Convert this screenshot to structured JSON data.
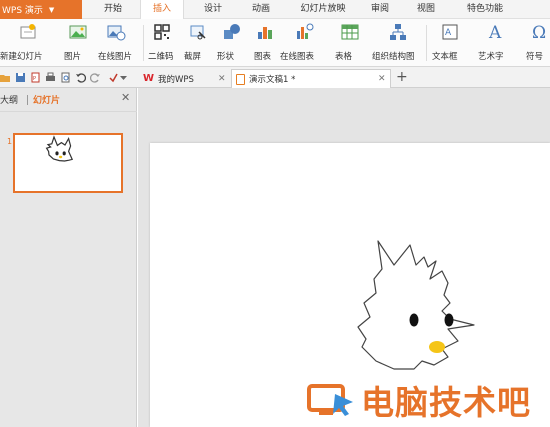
{
  "app": {
    "name": "WPS 演示"
  },
  "menu": {
    "tabs": [
      {
        "label": "开始"
      },
      {
        "label": "插入"
      },
      {
        "label": "设计"
      },
      {
        "label": "动画"
      },
      {
        "label": "幻灯片放映"
      },
      {
        "label": "审阅"
      },
      {
        "label": "视图"
      },
      {
        "label": "特色功能"
      }
    ],
    "active_tab": "插入"
  },
  "ribbon": {
    "items": [
      {
        "label": "新建幻灯片",
        "icon": "new-slide-icon"
      },
      {
        "label": "图片",
        "icon": "picture-icon"
      },
      {
        "label": "在线图片",
        "icon": "online-picture-icon"
      },
      {
        "label": "二维码",
        "icon": "qrcode-icon"
      },
      {
        "label": "截屏",
        "icon": "screenshot-icon"
      },
      {
        "label": "形状",
        "icon": "shapes-icon"
      },
      {
        "label": "图表",
        "icon": "chart-icon"
      },
      {
        "label": "在线图表",
        "icon": "online-chart-icon"
      },
      {
        "label": "表格",
        "icon": "table-icon"
      },
      {
        "label": "组织结构图",
        "icon": "org-chart-icon"
      },
      {
        "label": "文本框",
        "icon": "textbox-icon"
      },
      {
        "label": "艺术字",
        "icon": "wordart-icon"
      },
      {
        "label": "符号",
        "icon": "symbol-icon"
      }
    ]
  },
  "doc_tabs": [
    {
      "label": "我的WPS",
      "active": false
    },
    {
      "label": "演示文稿1 *",
      "active": true
    }
  ],
  "left_pane": {
    "tabs": [
      {
        "label": "大纲"
      },
      {
        "label": "幻灯片"
      }
    ],
    "active_tab": "幻灯片",
    "slides": [
      {
        "number": "1"
      }
    ]
  },
  "watermark": {
    "text": "电脑技术吧"
  },
  "colors": {
    "accent": "#e6732a",
    "wps_red": "#d9262c",
    "beak": "#f5c518"
  }
}
